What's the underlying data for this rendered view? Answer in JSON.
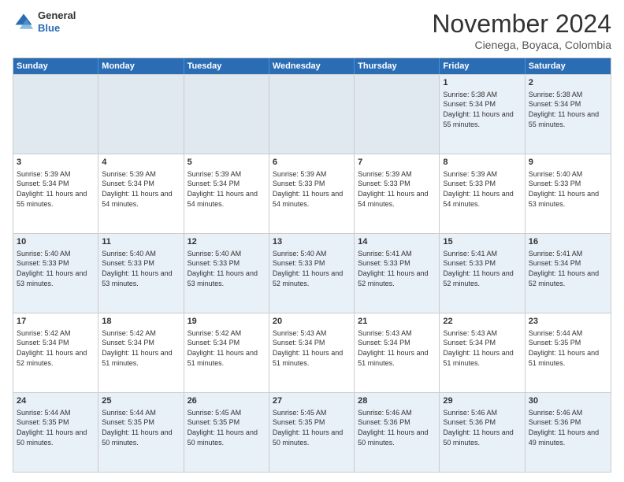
{
  "header": {
    "logo_general": "General",
    "logo_blue": "Blue",
    "month_title": "November 2024",
    "subtitle": "Cienega, Boyaca, Colombia"
  },
  "calendar": {
    "weekdays": [
      "Sunday",
      "Monday",
      "Tuesday",
      "Wednesday",
      "Thursday",
      "Friday",
      "Saturday"
    ],
    "rows": [
      [
        {
          "day": "",
          "text": ""
        },
        {
          "day": "",
          "text": ""
        },
        {
          "day": "",
          "text": ""
        },
        {
          "day": "",
          "text": ""
        },
        {
          "day": "",
          "text": ""
        },
        {
          "day": "1",
          "text": "Sunrise: 5:38 AM\nSunset: 5:34 PM\nDaylight: 11 hours and 55 minutes."
        },
        {
          "day": "2",
          "text": "Sunrise: 5:38 AM\nSunset: 5:34 PM\nDaylight: 11 hours and 55 minutes."
        }
      ],
      [
        {
          "day": "3",
          "text": "Sunrise: 5:39 AM\nSunset: 5:34 PM\nDaylight: 11 hours and 55 minutes."
        },
        {
          "day": "4",
          "text": "Sunrise: 5:39 AM\nSunset: 5:34 PM\nDaylight: 11 hours and 54 minutes."
        },
        {
          "day": "5",
          "text": "Sunrise: 5:39 AM\nSunset: 5:34 PM\nDaylight: 11 hours and 54 minutes."
        },
        {
          "day": "6",
          "text": "Sunrise: 5:39 AM\nSunset: 5:33 PM\nDaylight: 11 hours and 54 minutes."
        },
        {
          "day": "7",
          "text": "Sunrise: 5:39 AM\nSunset: 5:33 PM\nDaylight: 11 hours and 54 minutes."
        },
        {
          "day": "8",
          "text": "Sunrise: 5:39 AM\nSunset: 5:33 PM\nDaylight: 11 hours and 54 minutes."
        },
        {
          "day": "9",
          "text": "Sunrise: 5:40 AM\nSunset: 5:33 PM\nDaylight: 11 hours and 53 minutes."
        }
      ],
      [
        {
          "day": "10",
          "text": "Sunrise: 5:40 AM\nSunset: 5:33 PM\nDaylight: 11 hours and 53 minutes."
        },
        {
          "day": "11",
          "text": "Sunrise: 5:40 AM\nSunset: 5:33 PM\nDaylight: 11 hours and 53 minutes."
        },
        {
          "day": "12",
          "text": "Sunrise: 5:40 AM\nSunset: 5:33 PM\nDaylight: 11 hours and 53 minutes."
        },
        {
          "day": "13",
          "text": "Sunrise: 5:40 AM\nSunset: 5:33 PM\nDaylight: 11 hours and 52 minutes."
        },
        {
          "day": "14",
          "text": "Sunrise: 5:41 AM\nSunset: 5:33 PM\nDaylight: 11 hours and 52 minutes."
        },
        {
          "day": "15",
          "text": "Sunrise: 5:41 AM\nSunset: 5:33 PM\nDaylight: 11 hours and 52 minutes."
        },
        {
          "day": "16",
          "text": "Sunrise: 5:41 AM\nSunset: 5:34 PM\nDaylight: 11 hours and 52 minutes."
        }
      ],
      [
        {
          "day": "17",
          "text": "Sunrise: 5:42 AM\nSunset: 5:34 PM\nDaylight: 11 hours and 52 minutes."
        },
        {
          "day": "18",
          "text": "Sunrise: 5:42 AM\nSunset: 5:34 PM\nDaylight: 11 hours and 51 minutes."
        },
        {
          "day": "19",
          "text": "Sunrise: 5:42 AM\nSunset: 5:34 PM\nDaylight: 11 hours and 51 minutes."
        },
        {
          "day": "20",
          "text": "Sunrise: 5:43 AM\nSunset: 5:34 PM\nDaylight: 11 hours and 51 minutes."
        },
        {
          "day": "21",
          "text": "Sunrise: 5:43 AM\nSunset: 5:34 PM\nDaylight: 11 hours and 51 minutes."
        },
        {
          "day": "22",
          "text": "Sunrise: 5:43 AM\nSunset: 5:34 PM\nDaylight: 11 hours and 51 minutes."
        },
        {
          "day": "23",
          "text": "Sunrise: 5:44 AM\nSunset: 5:35 PM\nDaylight: 11 hours and 51 minutes."
        }
      ],
      [
        {
          "day": "24",
          "text": "Sunrise: 5:44 AM\nSunset: 5:35 PM\nDaylight: 11 hours and 50 minutes."
        },
        {
          "day": "25",
          "text": "Sunrise: 5:44 AM\nSunset: 5:35 PM\nDaylight: 11 hours and 50 minutes."
        },
        {
          "day": "26",
          "text": "Sunrise: 5:45 AM\nSunset: 5:35 PM\nDaylight: 11 hours and 50 minutes."
        },
        {
          "day": "27",
          "text": "Sunrise: 5:45 AM\nSunset: 5:35 PM\nDaylight: 11 hours and 50 minutes."
        },
        {
          "day": "28",
          "text": "Sunrise: 5:46 AM\nSunset: 5:36 PM\nDaylight: 11 hours and 50 minutes."
        },
        {
          "day": "29",
          "text": "Sunrise: 5:46 AM\nSunset: 5:36 PM\nDaylight: 11 hours and 50 minutes."
        },
        {
          "day": "30",
          "text": "Sunrise: 5:46 AM\nSunset: 5:36 PM\nDaylight: 11 hours and 49 minutes."
        }
      ]
    ]
  }
}
